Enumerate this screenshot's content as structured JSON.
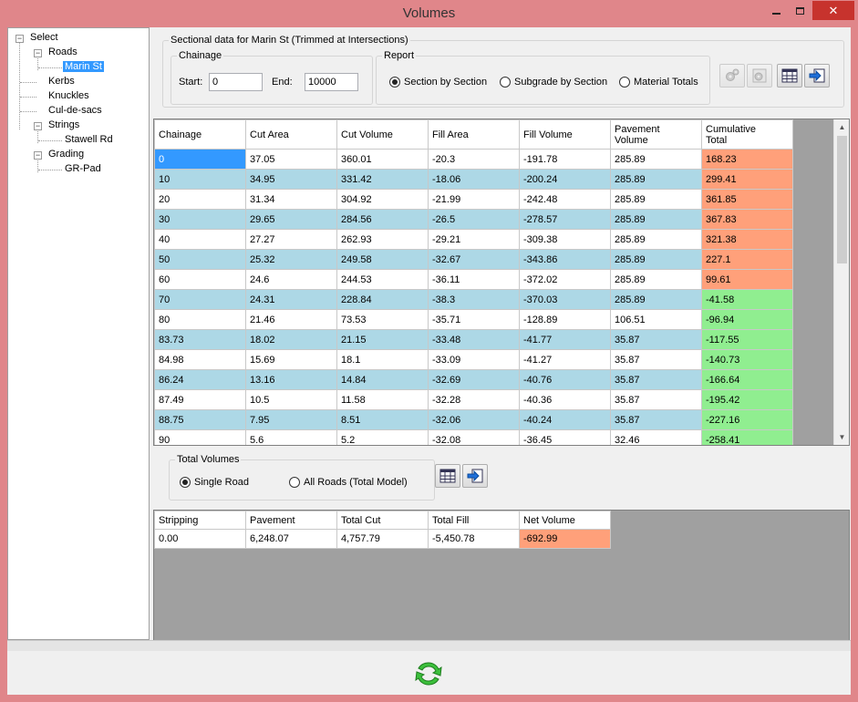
{
  "window": {
    "title": "Volumes"
  },
  "tree": {
    "root": "Select",
    "roads": "Roads",
    "road_item": "Marin St",
    "kerbs": "Kerbs",
    "knuckles": "Knuckles",
    "culdesacs": "Cul-de-sacs",
    "strings": "Strings",
    "string_item": "Stawell Rd",
    "grading": "Grading",
    "grading_item": "GR-Pad"
  },
  "sectional": {
    "title": "Sectional data for Marin St (Trimmed at Intersections)",
    "chainage_title": "Chainage",
    "start_label": "Start:",
    "start_value": "0",
    "end_label": "End:",
    "end_value": "10000",
    "report_title": "Report",
    "report_options": [
      "Section by Section",
      "Subgrade by Section",
      "Material Totals"
    ],
    "report_selected": 0
  },
  "grid": {
    "headers": [
      "Chainage",
      "Cut Area",
      "Cut Volume",
      "Fill Area",
      "Fill Volume",
      "Pavement\nVolume",
      "Cumulative\nTotal"
    ],
    "rows": [
      [
        "0",
        "37.05",
        "360.01",
        "-20.3",
        "-191.78",
        "285.89",
        "168.23"
      ],
      [
        "10",
        "34.95",
        "331.42",
        "-18.06",
        "-200.24",
        "285.89",
        "299.41"
      ],
      [
        "20",
        "31.34",
        "304.92",
        "-21.99",
        "-242.48",
        "285.89",
        "361.85"
      ],
      [
        "30",
        "29.65",
        "284.56",
        "-26.5",
        "-278.57",
        "285.89",
        "367.83"
      ],
      [
        "40",
        "27.27",
        "262.93",
        "-29.21",
        "-309.38",
        "285.89",
        "321.38"
      ],
      [
        "50",
        "25.32",
        "249.58",
        "-32.67",
        "-343.86",
        "285.89",
        "227.1"
      ],
      [
        "60",
        "24.6",
        "244.53",
        "-36.11",
        "-372.02",
        "285.89",
        "99.61"
      ],
      [
        "70",
        "24.31",
        "228.84",
        "-38.3",
        "-370.03",
        "285.89",
        "-41.58"
      ],
      [
        "80",
        "21.46",
        "73.53",
        "-35.71",
        "-128.89",
        "106.51",
        "-96.94"
      ],
      [
        "83.73",
        "18.02",
        "21.15",
        "-33.48",
        "-41.77",
        "35.87",
        "-117.55"
      ],
      [
        "84.98",
        "15.69",
        "18.1",
        "-33.09",
        "-41.27",
        "35.87",
        "-140.73"
      ],
      [
        "86.24",
        "13.16",
        "14.84",
        "-32.69",
        "-40.76",
        "35.87",
        "-166.64"
      ],
      [
        "87.49",
        "10.5",
        "11.58",
        "-32.28",
        "-40.36",
        "35.87",
        "-195.42"
      ],
      [
        "88.75",
        "7.95",
        "8.51",
        "-32.06",
        "-40.24",
        "35.87",
        "-227.16"
      ],
      [
        "90",
        "5.6",
        "5.2",
        "-32.08",
        "-36.45",
        "32.46",
        "-258.41"
      ]
    ]
  },
  "totals": {
    "title": "Total Volumes",
    "options": [
      "Single Road",
      "All Roads (Total Model)"
    ],
    "selected": 0
  },
  "summary": {
    "headers": [
      "Stripping",
      "Pavement",
      "Total Cut",
      "Total Fill",
      "Net Volume"
    ],
    "values": [
      "0.00",
      "6,248.07",
      "4,757.79",
      "-5,450.78",
      "-692.99"
    ]
  },
  "colors": {
    "row_alt": "#add8e6",
    "positive": "#ffa07a",
    "negative": "#90ee90",
    "selection": "#3399ff",
    "title_bar": "#e0868a",
    "close_button": "#c7332d"
  },
  "icons": {
    "window_close": "close-icon",
    "window_min": "minimize-icon",
    "window_max": "maximize-icon",
    "refresh": "refresh-icon"
  }
}
